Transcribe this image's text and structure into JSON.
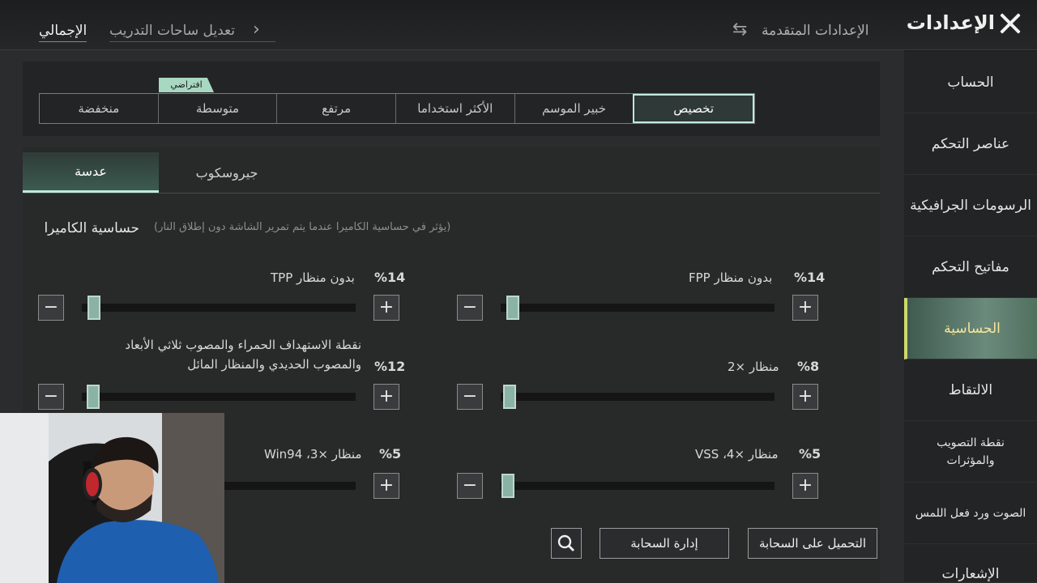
{
  "header": {
    "title": "الإعدادات",
    "advanced": "الإعدادات المتقدمة",
    "crumb_total": "الإجمالي",
    "crumb_edit": "تعديل ساحات التدريب"
  },
  "sidebar": {
    "items": [
      {
        "label": "الحساب"
      },
      {
        "label": "عناصر التحكم"
      },
      {
        "label": "الرسومات الجرافيكية"
      },
      {
        "label": "مفاتيح التحكم"
      },
      {
        "label": "الحساسية"
      },
      {
        "label": "الالتقاط"
      },
      {
        "label": "نقطة التصويب والمؤثرات"
      },
      {
        "label": "الصوت ورد فعل اللمس"
      },
      {
        "label": "الإشعارات"
      }
    ]
  },
  "presets": {
    "default_tag": "افتراضي",
    "items": [
      "تخصيص",
      "خبير الموسم",
      "الأكثر استخداما",
      "مرتفع",
      "متوسطة",
      "منخفضة"
    ]
  },
  "tabs": {
    "lens": "عدسة",
    "gyro": "جيروسكوب"
  },
  "section": {
    "title": "حساسية الكاميرا",
    "note": "(يؤثر في حساسية الكاميرا عندما يتم تمرير الشاشة دون إطلاق النار)"
  },
  "sliders": [
    {
      "label": "بدون منظار FPP",
      "pct": "%14",
      "value": 14
    },
    {
      "label": "بدون منظار TPP",
      "pct": "%14",
      "value": 14
    },
    {
      "label": "منظار ×2",
      "pct": "%8",
      "value": 8
    },
    {
      "label": "نقطة الاستهداف الحمراء والمصوب ثلاثي الأبعاد والمصوب الحديدي والمنظار المائل",
      "pct": "%12",
      "value": 12
    },
    {
      "label": "منظار ×4، VSS",
      "pct": "%5",
      "value": 5
    },
    {
      "label": "منظار ×3، Win94",
      "pct": "%5",
      "value": 5
    }
  ],
  "buttons": {
    "upload": "التحميل على السحابة",
    "manage": "إدارة السحابة"
  }
}
